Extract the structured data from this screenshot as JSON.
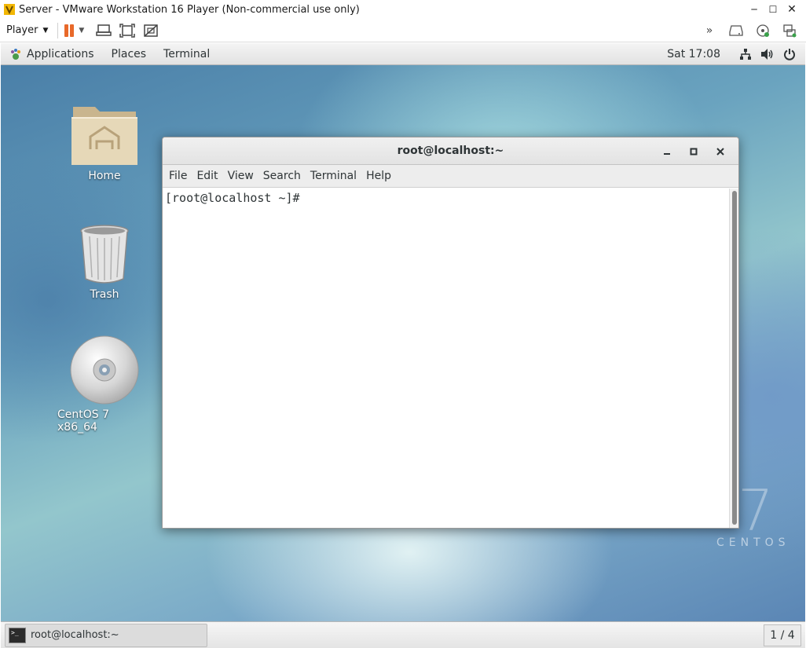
{
  "vm_window": {
    "title": "Server - VMware Workstation 16 Player (Non-commercial use only)",
    "minimize": "─",
    "maximize": "☐",
    "close": "✕"
  },
  "vm_toolbar": {
    "player_menu_label": "Player"
  },
  "gnome_panel": {
    "applications": "Applications",
    "places": "Places",
    "terminal": "Terminal",
    "clock": "Sat 17:08"
  },
  "desktop": {
    "icons": [
      {
        "label": "Home"
      },
      {
        "label": "Trash"
      },
      {
        "label": "CentOS 7 x86_64"
      }
    ],
    "watermark_number": "7",
    "watermark_text": "CENTOS"
  },
  "terminal": {
    "title": "root@localhost:~",
    "menu": [
      "File",
      "Edit",
      "View",
      "Search",
      "Terminal",
      "Help"
    ],
    "prompt": "[root@localhost ~]#"
  },
  "taskbar": {
    "task_label": "root@localhost:~",
    "workspace": "1 / 4"
  },
  "colors": {
    "pause_accent": "#e8692a",
    "panel_bg": "#e9e9e9",
    "terminal_bg": "#ffffff"
  }
}
